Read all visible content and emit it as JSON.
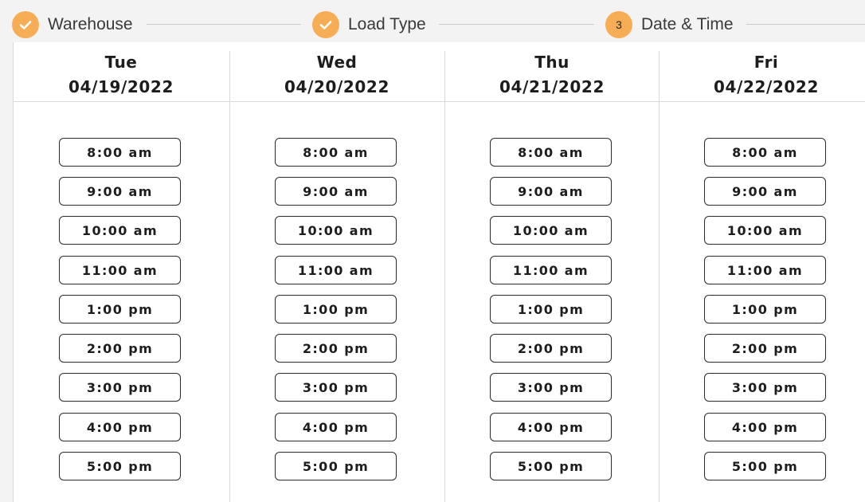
{
  "stepper": {
    "steps": [
      {
        "label": "Warehouse",
        "state": "completed",
        "icon": "check-icon"
      },
      {
        "label": "Load Type",
        "state": "completed",
        "icon": "check-icon"
      },
      {
        "label": "Date & Time",
        "state": "current",
        "number": "3"
      }
    ],
    "accent_color": "#f6ad55"
  },
  "days": [
    {
      "name": "Tue",
      "date": "04/19/2022",
      "slots": [
        "8:00 am",
        "9:00 am",
        "10:00 am",
        "11:00 am",
        "1:00 pm",
        "2:00 pm",
        "3:00 pm",
        "4:00 pm",
        "5:00 pm"
      ]
    },
    {
      "name": "Wed",
      "date": "04/20/2022",
      "slots": [
        "8:00 am",
        "9:00 am",
        "10:00 am",
        "11:00 am",
        "1:00 pm",
        "2:00 pm",
        "3:00 pm",
        "4:00 pm",
        "5:00 pm"
      ]
    },
    {
      "name": "Thu",
      "date": "04/21/2022",
      "slots": [
        "8:00 am",
        "9:00 am",
        "10:00 am",
        "11:00 am",
        "1:00 pm",
        "2:00 pm",
        "3:00 pm",
        "4:00 pm",
        "5:00 pm"
      ]
    },
    {
      "name": "Fri",
      "date": "04/22/2022",
      "slots": [
        "8:00 am",
        "9:00 am",
        "10:00 am",
        "11:00 am",
        "1:00 pm",
        "2:00 pm",
        "3:00 pm",
        "4:00 pm",
        "5:00 pm"
      ]
    }
  ]
}
